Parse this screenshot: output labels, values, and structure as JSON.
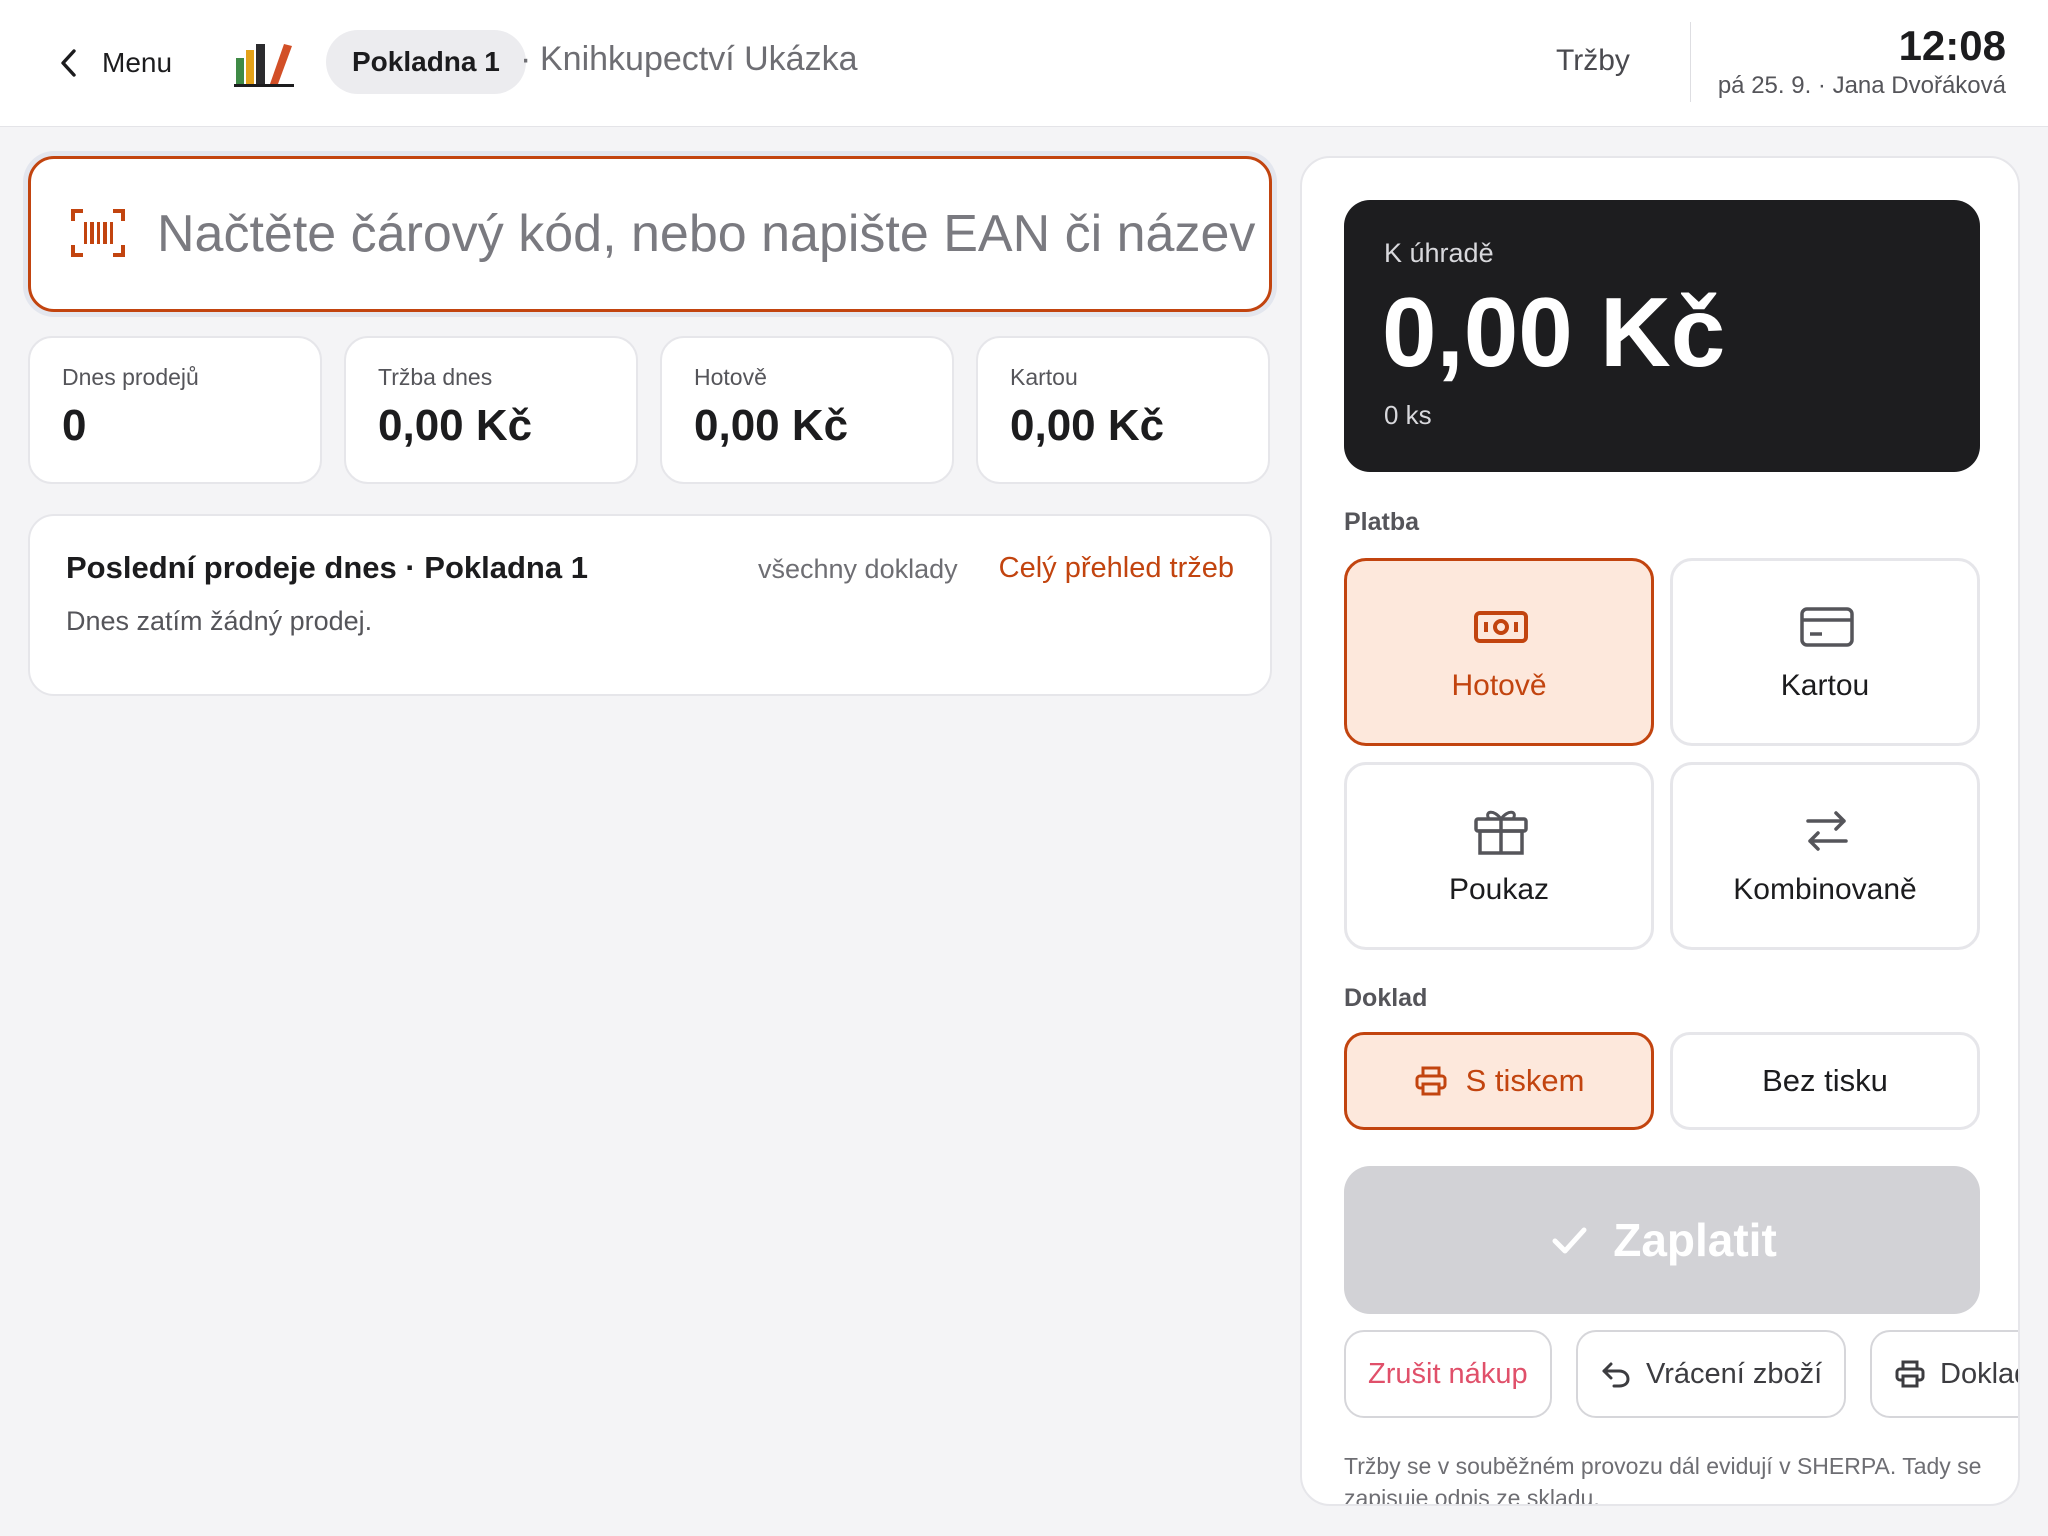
{
  "header": {
    "back_label": "Menu",
    "register": "Pokladna 1",
    "separator": "·",
    "store": "Knihkupectví Ukázka",
    "revenue_link": "Tržby",
    "time": "12:08",
    "date_user": "pá 25. 9. · Jana Dvořáková"
  },
  "search": {
    "placeholder": "Načtěte čárový kód, nebo napište EAN či název",
    "value": ""
  },
  "stats": [
    {
      "label": "Dnes prodejů",
      "value": "0"
    },
    {
      "label": "Tržba dnes",
      "value": "0,00 Kč"
    },
    {
      "label": "Hotově",
      "value": "0,00 Kč"
    },
    {
      "label": "Kartou",
      "value": "0,00 Kč"
    }
  ],
  "recent": {
    "title": "Poslední prodeje dnes · Pokladna 1",
    "all_link": "všechny doklady",
    "overview_link": "Celý přehled tržeb",
    "empty": "Dnes zatím žádný prodej."
  },
  "due": {
    "label": "K úhradě",
    "amount": "0,00 Kč",
    "count": "0 ks"
  },
  "payment": {
    "label": "Platba",
    "methods": [
      {
        "label": "Hotově",
        "icon": "cash-icon",
        "selected": true
      },
      {
        "label": "Kartou",
        "icon": "card-icon",
        "selected": false
      },
      {
        "label": "Poukaz",
        "icon": "gift-icon",
        "selected": false
      },
      {
        "label": "Kombinovaně",
        "icon": "swap-icon",
        "selected": false
      }
    ]
  },
  "receipt": {
    "label": "Doklad",
    "options": [
      {
        "label": "S tiskem",
        "icon": "printer-icon",
        "selected": true
      },
      {
        "label": "Bez tisku",
        "selected": false
      }
    ]
  },
  "pay_button": {
    "label": "Zaplatit",
    "icon": "check-icon"
  },
  "actions": [
    {
      "label": "Zrušit nákup"
    },
    {
      "label": "Vrácení zboží",
      "icon": "undo-icon"
    },
    {
      "label": "Doklad",
      "icon": "printer-icon"
    }
  ],
  "footnote": "Tržby se v souběžném provozu dál evidují v SHERPA. Tady se zapisuje odpis ze skladu.",
  "colors": {
    "accent": "#c2440f",
    "accent_bg": "#fde8dc",
    "dark_card": "#1d1d1f",
    "cancel": "#e0506a",
    "disabled": "#d2d2d6"
  }
}
